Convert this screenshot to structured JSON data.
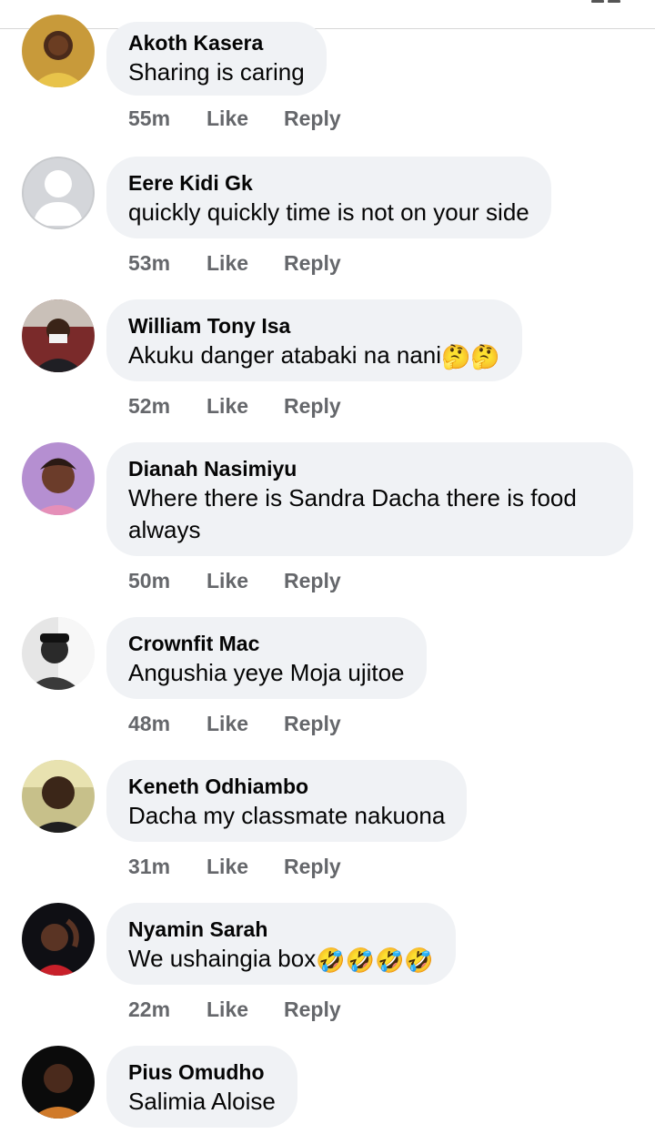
{
  "comments": [
    {
      "author": "Akoth Kasera",
      "text": "Sharing is caring",
      "time": "55m",
      "like": "Like",
      "reply": "Reply"
    },
    {
      "author": "Eere Kidi Gk",
      "text": "quickly quickly time is not on your side",
      "time": "53m",
      "like": "Like",
      "reply": "Reply"
    },
    {
      "author": "William Tony Isa",
      "text": "Akuku danger atabaki na nani",
      "emoji": "🤔🤔",
      "time": "52m",
      "like": "Like",
      "reply": "Reply"
    },
    {
      "author": "Dianah Nasimiyu",
      "text": "Where there is Sandra Dacha there is food always",
      "time": "50m",
      "like": "Like",
      "reply": "Reply"
    },
    {
      "author": "Crownfit Mac",
      "text": "Angushia yeye Moja ujitoe",
      "time": "48m",
      "like": "Like",
      "reply": "Reply"
    },
    {
      "author": "Keneth Odhiambo",
      "text": "Dacha my classmate nakuona",
      "time": "31m",
      "like": "Like",
      "reply": "Reply"
    },
    {
      "author": "Nyamin Sarah",
      "text": "We ushaingia box",
      "emoji": "🤣🤣🤣🤣",
      "time": "22m",
      "like": "Like",
      "reply": "Reply"
    },
    {
      "author": "Pius Omudho",
      "text": "Salimia Aloise"
    }
  ]
}
